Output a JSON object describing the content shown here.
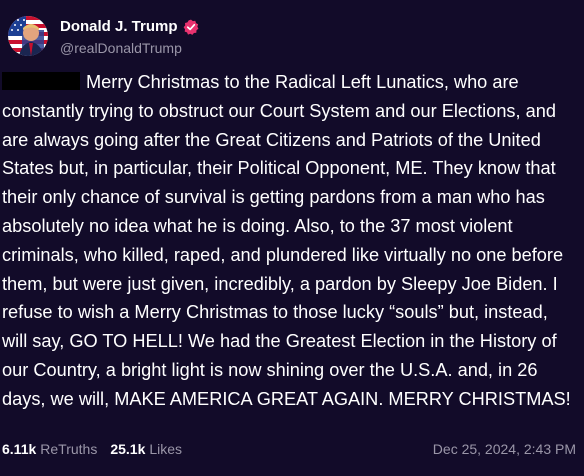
{
  "author": {
    "display_name": "Donald J. Trump",
    "handle": "@realDonaldTrump",
    "avatar_icon": "avatar-portrait-flag",
    "verified_icon": "verified-badge-icon",
    "verified_color": "#e8326f"
  },
  "post": {
    "text": "Merry Christmas to the Radical Left Lunatics, who are constantly trying to obstruct our Court System and our Elections, and are always going after the Great Citizens and Patriots of the United States but, in particular, their Political Opponent, ME. They know that their only chance of survival is getting pardons from a man who has absolutely no idea what he is doing. Also, to the 37 most violent criminals, who killed, raped, and plundered like virtually no one before them, but were just given, incredibly, a pardon by Sleepy Joe Biden. I refuse to wish a Merry Christmas to those lucky “souls” but, instead, will say, GO TO HELL! We had the Greatest Election in the History of our Country, a bright light is now shining over the U.S.A. and, in 26 days, we will, MAKE AMERICA GREAT AGAIN. MERRY CHRISTMAS!"
  },
  "stats": {
    "retruths_count": "6.11k",
    "retruths_label": "ReTruths",
    "likes_count": "25.1k",
    "likes_label": "Likes"
  },
  "timestamp": "Dec 25, 2024, 2:43 PM",
  "colors": {
    "background": "#120b29",
    "text": "#ffffff",
    "muted": "#9a96a8"
  }
}
